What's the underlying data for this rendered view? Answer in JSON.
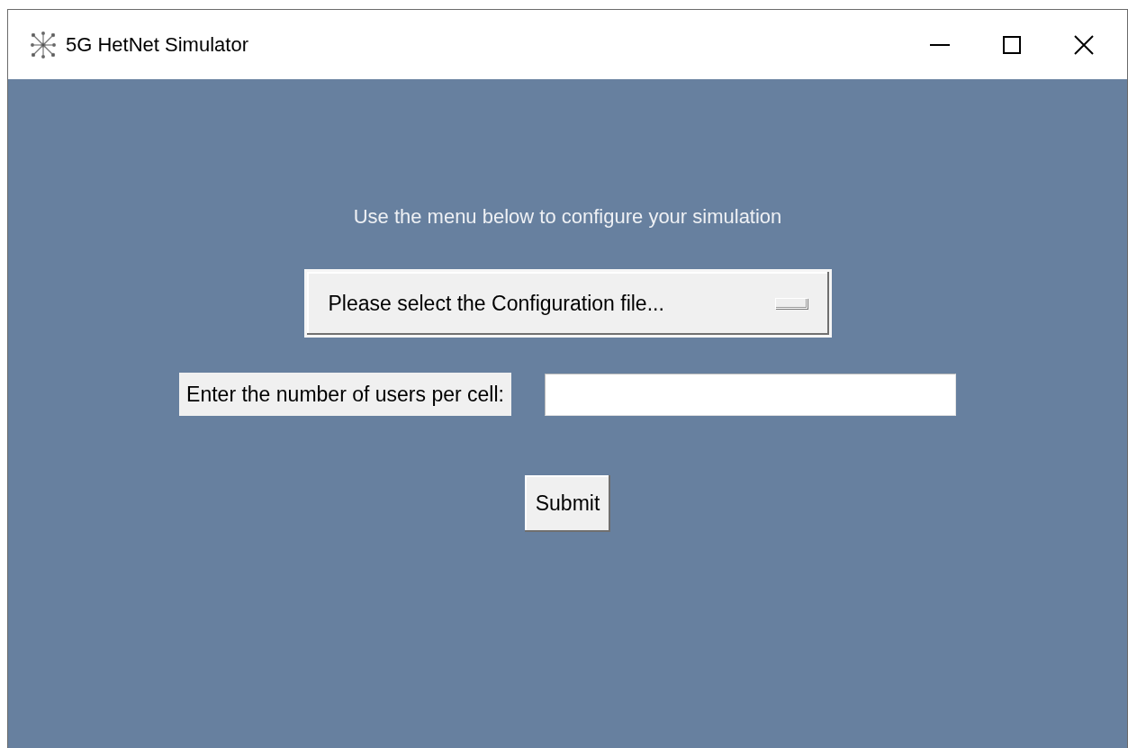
{
  "window": {
    "title": "5G HetNet Simulator"
  },
  "instruction": "Use the menu below to configure your simulation",
  "config_menu": {
    "label": "Please select the Configuration file..."
  },
  "users_field": {
    "label": "Enter the number of users per cell:"
  },
  "submit_button": {
    "label": "Submit"
  }
}
